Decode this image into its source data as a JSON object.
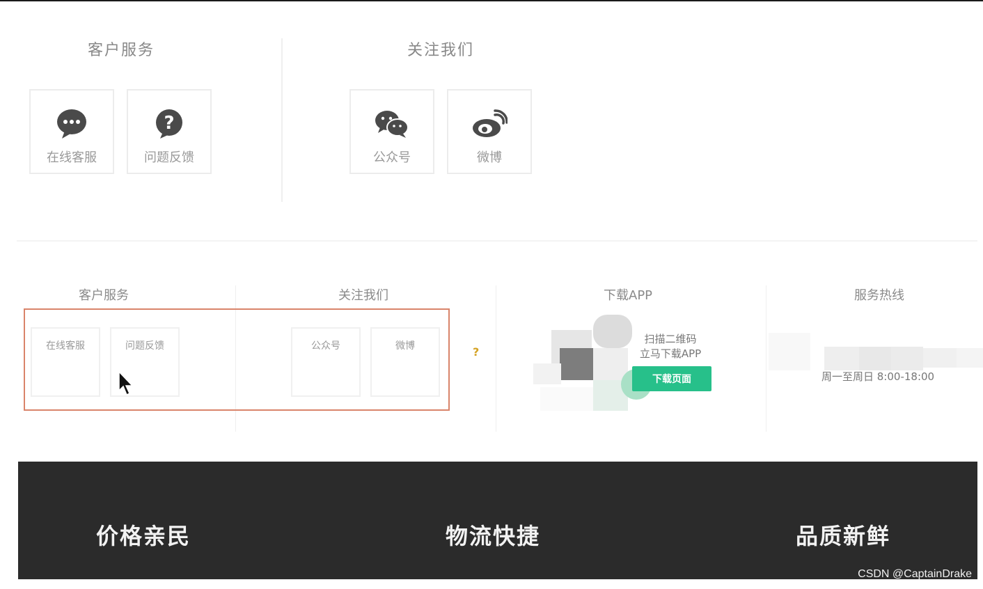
{
  "upper": {
    "customer_service": {
      "title": "客户服务",
      "items": [
        {
          "label": "在线客服",
          "icon": "chat-bubble-icon"
        },
        {
          "label": "问题反馈",
          "icon": "question-icon"
        }
      ]
    },
    "follow_us": {
      "title": "关注我们",
      "items": [
        {
          "label": "公众号",
          "icon": "wechat-icon"
        },
        {
          "label": "微博",
          "icon": "weibo-icon"
        }
      ]
    }
  },
  "lower": {
    "customer_service": {
      "title": "客户服务",
      "items": [
        {
          "label": "在线客服"
        },
        {
          "label": "问题反馈"
        }
      ]
    },
    "follow_us": {
      "title": "关注我们",
      "items": [
        {
          "label": "公众号"
        },
        {
          "label": "微博"
        }
      ]
    },
    "question_mark": "?",
    "download_app": {
      "title": "下载APP",
      "line1": "扫描二维码",
      "line2": "立马下载APP",
      "button_label": "下载页面"
    },
    "hotline": {
      "title": "服务热线",
      "hours": "周一至周日 8:00-18:00"
    }
  },
  "banner": {
    "items": [
      "价格亲民",
      "物流快捷",
      "品质新鲜"
    ]
  },
  "watermark": "CSDN @CaptainDrake",
  "colors": {
    "accent_green": "#27c08a",
    "highlight_border": "#d9846a",
    "banner_bg": "#2b2b2b",
    "question_mark": "#d5a325"
  }
}
